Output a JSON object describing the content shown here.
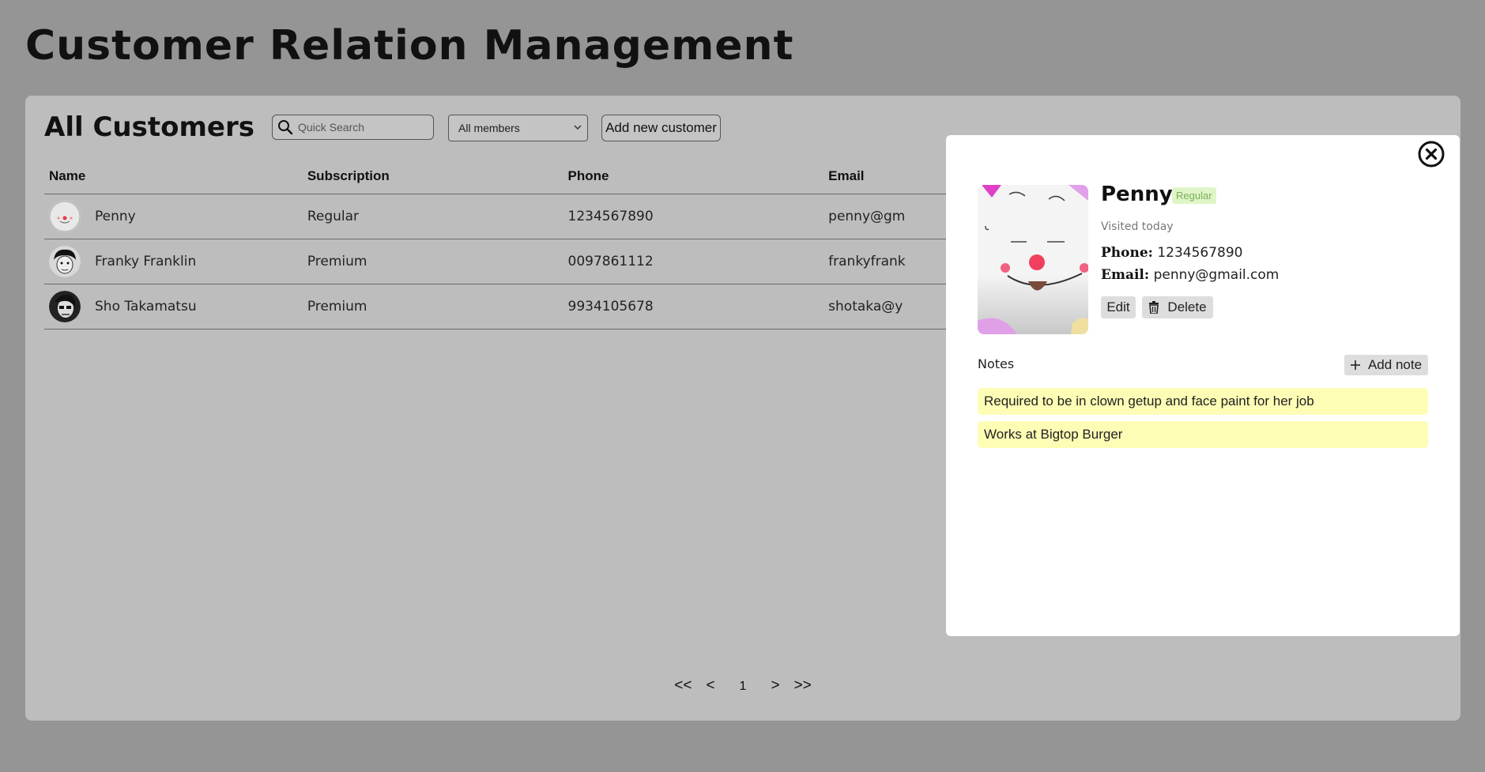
{
  "app": {
    "title": "Customer Relation Management"
  },
  "toolbar": {
    "heading": "All Customers",
    "search_placeholder": "Quick Search",
    "filter_selected": "All members",
    "add_label": "Add new customer"
  },
  "table": {
    "headers": [
      "Name",
      "Subscription",
      "Phone",
      "Email"
    ],
    "rows": [
      {
        "name": "Penny",
        "subscription": "Regular",
        "phone": "1234567890",
        "email": "penny@gm"
      },
      {
        "name": "Franky Franklin",
        "subscription": "Premium",
        "phone": "0097861112",
        "email": "frankyfrank"
      },
      {
        "name": "Sho Takamatsu",
        "subscription": "Premium",
        "phone": "9934105678",
        "email": "shotaka@y"
      }
    ]
  },
  "pagination": {
    "first": "<<",
    "prev": "<",
    "page": "1",
    "next": ">",
    "last": ">>"
  },
  "detail": {
    "name": "Penny",
    "badge": "Regular",
    "visited": "Visited today",
    "phone_label": "Phone:",
    "phone": "1234567890",
    "email_label": "Email:",
    "email": "penny@gmail.com",
    "edit_label": "Edit",
    "delete_label": "Delete",
    "notes_label": "Notes",
    "add_note_label": "Add note",
    "notes": [
      "Required to be in clown getup and face paint for her job",
      "Works at Bigtop Burger"
    ]
  },
  "colors": {
    "overlay_bg": "#959595",
    "panel_bg": "#bdbdbd",
    "badge_bg": "#dff5c8",
    "badge_text": "#7cad5a",
    "note_bg": "#fdfdb5"
  },
  "icons": [
    "search-icon",
    "chevron-down-icon",
    "close-icon",
    "plus-icon",
    "trash-icon"
  ]
}
